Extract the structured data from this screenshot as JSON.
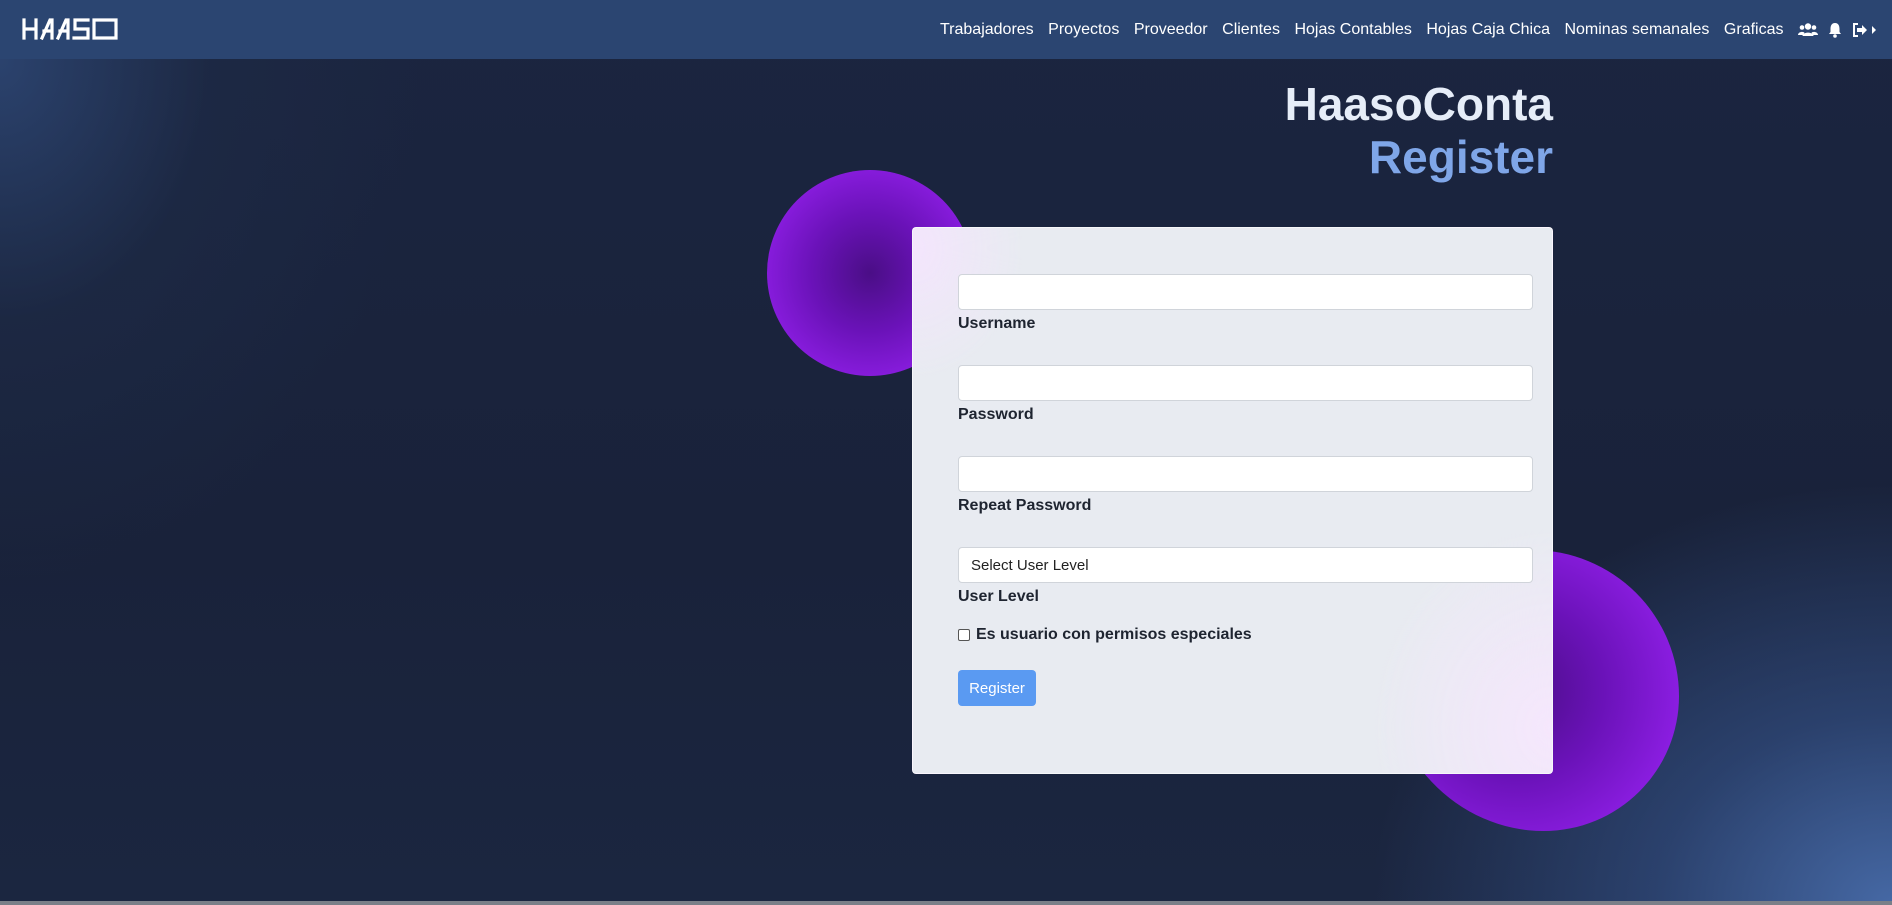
{
  "brand": {
    "logo_text": "HAASO"
  },
  "nav": {
    "links": [
      "Trabajadores",
      "Proyectos",
      "Proveedor",
      "Clientes",
      "Hojas Contables",
      "Hojas Caja Chica",
      "Nominas semanales",
      "Graficas"
    ],
    "icons": [
      "users-icon",
      "bell-icon",
      "logout-icon"
    ]
  },
  "header": {
    "app_title": "HaasoConta",
    "page_title": "Register"
  },
  "form": {
    "username": {
      "label": "Username",
      "value": "",
      "placeholder": ""
    },
    "password": {
      "label": "Password",
      "value": "",
      "placeholder": ""
    },
    "repeat_password": {
      "label": "Repeat Password",
      "value": "",
      "placeholder": ""
    },
    "user_level": {
      "label": "User Level",
      "selected": "Select User Level"
    },
    "special_permissions": {
      "label": "Es usuario con permisos especiales",
      "checked": false
    },
    "submit_label": "Register"
  },
  "colors": {
    "navbar": "#2b4571",
    "title_primary": "#e6edf8",
    "title_accent": "#7fa6e8",
    "button": "#5a9af2",
    "blob": "#8a1de0"
  }
}
